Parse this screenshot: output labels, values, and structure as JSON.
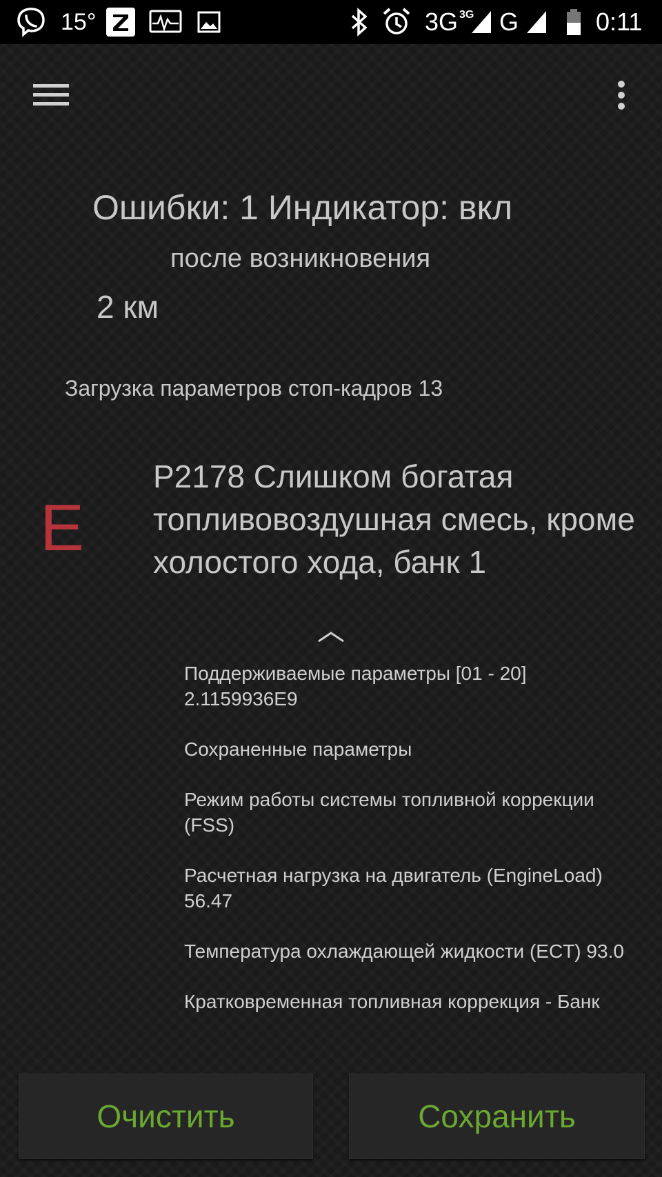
{
  "status_bar": {
    "temperature": "15°",
    "time": "0:11",
    "network_3g": "3G",
    "network_3g_sup": "3G",
    "network_g": "G",
    "icons": [
      "viber-icon",
      "zen-icon",
      "obd-monitor-icon",
      "image-icon",
      "bluetooth-icon",
      "alarm-icon",
      "signal-3g-icon",
      "signal-g-icon",
      "battery-icon"
    ]
  },
  "toolbar": {
    "menu_icon": "hamburger-menu-icon",
    "overflow_icon": "overflow-menu-icon"
  },
  "summary": {
    "errors_line": "Ошибки: 1 Индикатор: вкл",
    "after_label": "после возникновения",
    "distance": "2 км",
    "freeze_frame_label": "Загрузка параметров стоп-кадров 13"
  },
  "trouble_code": {
    "type_letter": "E",
    "code": "P2178",
    "description": "Слишком богатая топливовоздушная смесь, кроме холостого хода, банк 1",
    "colors": {
      "letter": "#b5343a",
      "text": "#c8c8c8"
    }
  },
  "freeze_frame_params": [
    {
      "name": "Поддерживаемые параметры [01 - 20]",
      "value": "2.1159936E9"
    },
    {
      "name": "Сохраненные параметры",
      "value": ""
    },
    {
      "name": "Режим работы системы топливной коррекции (FSS)",
      "value": ""
    },
    {
      "name": "Расчетная нагрузка на двигатель (EngineLoad)",
      "value": "56.47"
    },
    {
      "name": "Температура охлаждающей жидкости (ECT)",
      "value": "93.0"
    },
    {
      "name": "Кратковременная топливная коррекция - Банк",
      "value": ""
    }
  ],
  "buttons": {
    "clear_label": "Очистить",
    "save_label": "Сохранить",
    "accent_color": "#6aa832"
  }
}
